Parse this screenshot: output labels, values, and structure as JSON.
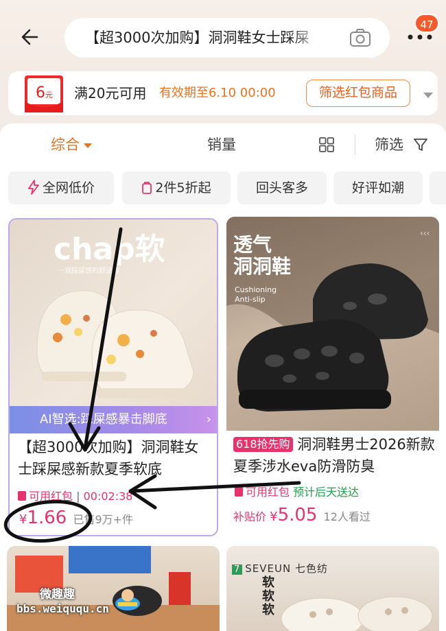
{
  "header": {
    "search_query": "【超3000次加购】洞洞鞋女士踩屎",
    "notification_count": "47"
  },
  "coupon": {
    "amount": "6",
    "unit": "元",
    "condition": "满20元可用",
    "expiry": "有效期至6.10 00:00",
    "button_label": "筛选红包商品"
  },
  "sort_bar": {
    "tabs": [
      "综合",
      "销量"
    ],
    "filter_label": "筛选"
  },
  "chips": [
    "全网低价",
    "2件5折起",
    "回头客多",
    "好评如潮"
  ],
  "products": [
    {
      "image_text": "chap软",
      "image_subtext": "一双踩屎感的舒适鞋",
      "ai_label": "AI智选:踩屎感暴击脚底",
      "title": "【超3000次加购】洞洞鞋女士踩屎感新款夏季软底",
      "coupon_tag": "可用红包",
      "countdown": "00:02:38",
      "currency": "¥",
      "price": "1.66",
      "sold": "已售9万+件"
    },
    {
      "image_title": "透气\n洞洞鞋",
      "image_features": "Cushioning\nAnti-slip",
      "tag": "618抢先购",
      "title": "洞洞鞋男士2026新款夏季涉水eva防滑防臭",
      "coupon_tag": "可用红包",
      "delivery": "预计后天送达",
      "subsidy_label": "补贴价",
      "currency": "¥",
      "price": "5.05",
      "viewers": "12人看过"
    }
  ],
  "partial_products": [
    {
      "brand_mark": "7",
      "brand": "SEVEUN 七色纺",
      "promo": "软软软"
    },
    {
      "brand": ""
    }
  ],
  "watermark": {
    "line1": "微趣趣",
    "line2": "bbs.weiququ.cn"
  },
  "colors": {
    "accent_orange": "#e8731e",
    "price_red": "#e8326b",
    "badge_orange": "#f55a2a",
    "delivery_green": "#1aa34a",
    "annotation_black": "#111111"
  }
}
